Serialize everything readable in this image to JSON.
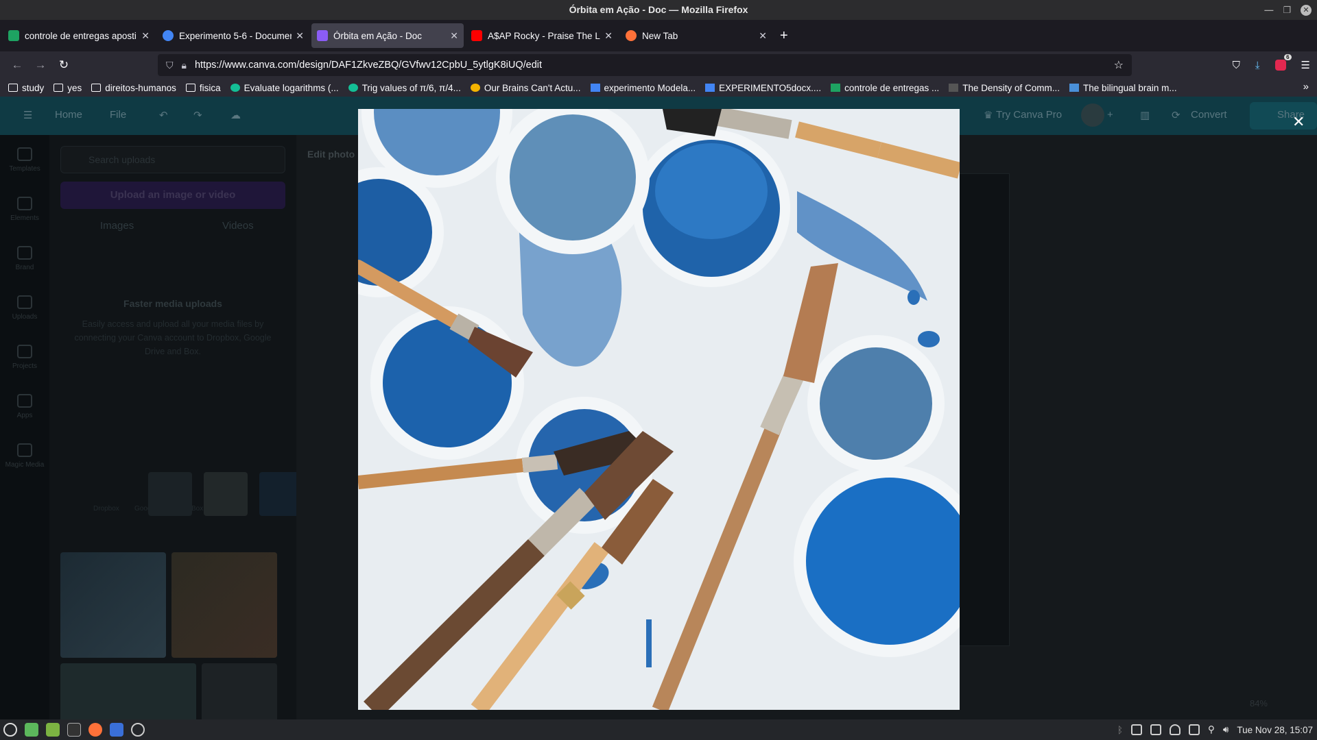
{
  "window": {
    "title": "Órbita em Ação - Doc — Mozilla Firefox"
  },
  "tabs": [
    {
      "label": "controle de entregas aposti",
      "icon": "google-sheets-icon",
      "color": "#1ea362"
    },
    {
      "label": "Experimento 5-6 - Documen",
      "icon": "google-docs-icon",
      "color": "#4285f4"
    },
    {
      "label": "Órbita em Ação - Doc",
      "icon": "canva-icon",
      "color": "#8b5cf6"
    },
    {
      "label": "A$AP Rocky - Praise The Lo",
      "icon": "youtube-icon",
      "color": "#ff0000"
    },
    {
      "label": "New Tab",
      "icon": "firefox-icon",
      "color": "#ff7139"
    }
  ],
  "navbar": {
    "url": "https://www.canva.com/design/DAF1ZkveZBQ/GVfwv12CpbU_5ytlgK8iUQ/edit",
    "extension_badge": "6"
  },
  "bookmarks": [
    {
      "label": "study",
      "icon": "folder-icon"
    },
    {
      "label": "yes",
      "icon": "folder-icon"
    },
    {
      "label": "direitos-humanos",
      "icon": "folder-icon"
    },
    {
      "label": "fisica",
      "icon": "folder-icon"
    },
    {
      "label": "Evaluate logarithms (...",
      "icon": "khan-academy-icon",
      "color": "#14bf96"
    },
    {
      "label": "Trig values of π/6, π/4...",
      "icon": "khan-academy-icon",
      "color": "#14bf96"
    },
    {
      "label": "Our Brains Can't Actu...",
      "icon": "site-icon",
      "color": "#f5b400"
    },
    {
      "label": "experimento Modela...",
      "icon": "google-docs-icon",
      "color": "#4285f4"
    },
    {
      "label": "EXPERIMENTO5docx....",
      "icon": "google-docs-icon",
      "color": "#4285f4"
    },
    {
      "label": "controle de entregas ...",
      "icon": "google-sheets-icon",
      "color": "#1ea362"
    },
    {
      "label": "The Density of Comm...",
      "icon": "site-icon",
      "color": "#555555"
    },
    {
      "label": "The bilingual brain m...",
      "icon": "site-icon",
      "color": "#4a90d9"
    }
  ],
  "canva": {
    "top_home": "Home",
    "top_file": "File",
    "try_pro": "Try Canva Pro",
    "convert": "Convert",
    "share": "Share",
    "rail": [
      "Templates",
      "Elements",
      "Brand",
      "Uploads",
      "Projects",
      "Apps",
      "Magic Media"
    ],
    "search_placeholder": "Search uploads",
    "upload_button": "Upload an image or video",
    "tab_images": "Images",
    "tab_videos": "Videos",
    "info_title": "Faster media uploads",
    "info_body": "Easily access and upload all your media files by connecting your Canva account to Dropbox, Google Drive and Box.",
    "providers": [
      "Dropbox",
      "Google Drive",
      "Box"
    ],
    "edit_photo": "Edit photo",
    "zoom": "84%"
  },
  "taskbar": {
    "clock": "Tue Nov 28, 15:07"
  }
}
